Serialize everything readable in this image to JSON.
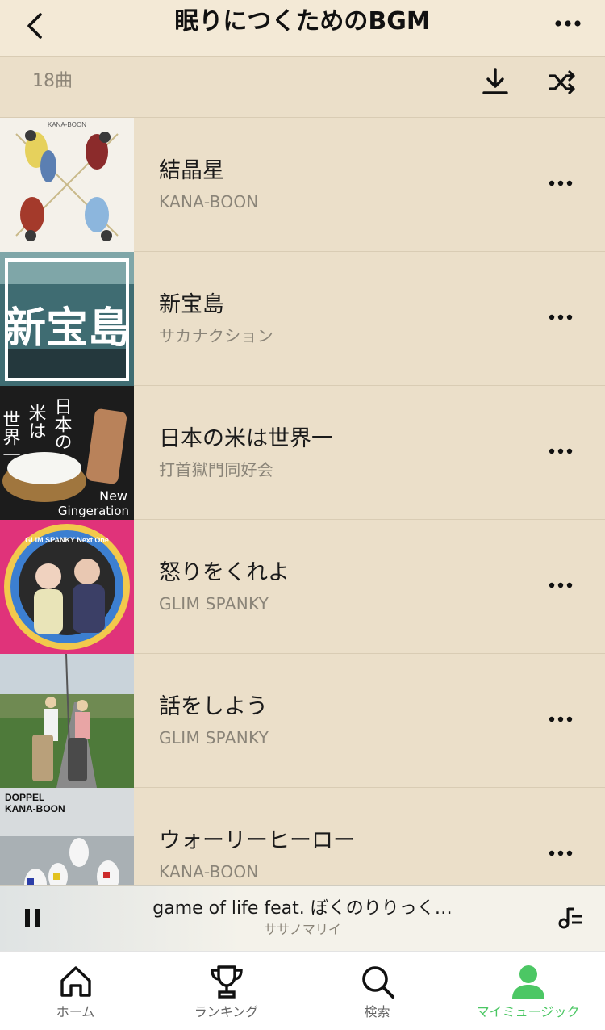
{
  "header": {
    "title": "眠りにつくためのBGM"
  },
  "subbar": {
    "track_count": "18曲"
  },
  "tracks": [
    {
      "title": "結晶星",
      "artist": "KANA-BOON"
    },
    {
      "title": "新宝島",
      "artist": "サカナクション"
    },
    {
      "title": "日本の米は世界一",
      "artist": "打首獄門同好会"
    },
    {
      "title": "怒りをくれよ",
      "artist": "GLIM SPANKY"
    },
    {
      "title": "話をしよう",
      "artist": "GLIM SPANKY"
    },
    {
      "title": "ウォーリーヒーロー",
      "artist": "KANA-BOON"
    }
  ],
  "album_art_text": {
    "art1_top": "KANA-BOON",
    "art2_main": "新宝島",
    "art3_left": "世界一",
    "art3_mid": "米は",
    "art3_right": "日本の",
    "art3_bottom1": "New",
    "art3_bottom2": "Gingeration",
    "art4_ring": "GLIM SPANKY  Next One",
    "art6_line1": "DOPPEL",
    "art6_line2": "KANA-BOON"
  },
  "player": {
    "title": "game of life feat. ぼくのりりっく…",
    "artist": "ササノマリイ"
  },
  "tabs": [
    {
      "label": "ホーム",
      "icon": "home-icon"
    },
    {
      "label": "ランキング",
      "icon": "trophy-icon"
    },
    {
      "label": "検索",
      "icon": "search-icon"
    },
    {
      "label": "マイミュージック",
      "icon": "person-icon"
    }
  ],
  "colors": {
    "background": "#ebdfc9",
    "header": "#f3e9d6",
    "accent": "#4cc764"
  }
}
